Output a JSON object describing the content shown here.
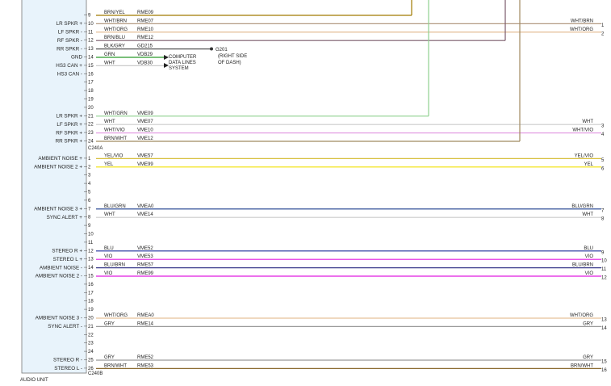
{
  "unit": {
    "name": "AUDIO UNIT",
    "fill": "#e8f3fb",
    "connectors": [
      {
        "name": "C240A",
        "after_pin": 24
      },
      {
        "name": "C240B",
        "after_pin": 48
      }
    ]
  },
  "ground": {
    "id": "G201",
    "note_lines": [
      "(RIGHT SIDE",
      "OF DASH)"
    ],
    "row": 13
  },
  "data_system": {
    "lines": [
      "COMPUTER",
      "DATA LINES",
      "SYSTEM"
    ],
    "rows": [
      14,
      15
    ]
  },
  "rows": [
    {
      "pin": "9",
      "signal": "",
      "color_text": "BRN/YEL",
      "circuit": "RME09",
      "wire": "#a07a00",
      "end": 510,
      "right_color": "",
      "right_num": ""
    },
    {
      "pin": "10",
      "signal": "LR SPKR +",
      "color_text": "WHT/BRN",
      "circuit": "RME07",
      "wire": "#b39a82",
      "end": 745,
      "right_color": "WHT/BRN",
      "right_num": "1"
    },
    {
      "pin": "11",
      "signal": "LF SPKR -",
      "color_text": "WHT/ORG",
      "circuit": "RME10",
      "wire": "#e0b68a",
      "end": 745,
      "right_color": "WHT/ORG",
      "right_num": "2"
    },
    {
      "pin": "12",
      "signal": "RF SPKR -",
      "color_text": "BRN/BLU",
      "circuit": "RME12",
      "wire": "#7a5a6a",
      "end": 626,
      "right_color": "",
      "right_num": ""
    },
    {
      "pin": "13",
      "signal": "RR SPKR -",
      "color_text": "BLK/GRY",
      "circuit": "GD215",
      "wire": "#555555",
      "end": 262,
      "right_color": "",
      "right_num": ""
    },
    {
      "pin": "14",
      "signal": "GND",
      "color_text": "GRN",
      "circuit": "VDB29",
      "wire": "#2a9a2a",
      "end": 203,
      "right_color": "",
      "right_num": ""
    },
    {
      "pin": "15",
      "signal": "HS3 CAN +",
      "color_text": "WHT",
      "circuit": "VDB30",
      "wire": "#cccccc",
      "end": 203,
      "right_color": "",
      "right_num": ""
    },
    {
      "pin": "16",
      "signal": "HS3 CAN -",
      "color_text": "",
      "circuit": "",
      "wire": "",
      "end": 0,
      "right_color": "",
      "right_num": ""
    },
    {
      "pin": "17",
      "signal": "",
      "color_text": "",
      "circuit": "",
      "wire": "",
      "end": 0,
      "right_color": "",
      "right_num": ""
    },
    {
      "pin": "18",
      "signal": "",
      "color_text": "",
      "circuit": "",
      "wire": "",
      "end": 0,
      "right_color": "",
      "right_num": ""
    },
    {
      "pin": "19",
      "signal": "",
      "color_text": "",
      "circuit": "",
      "wire": "",
      "end": 0,
      "right_color": "",
      "right_num": ""
    },
    {
      "pin": "20",
      "signal": "",
      "color_text": "",
      "circuit": "",
      "wire": "",
      "end": 0,
      "right_color": "",
      "right_num": ""
    },
    {
      "pin": "21",
      "signal": "LR SPKR +",
      "color_text": "WHT/GRN",
      "circuit": "VME09",
      "wire": "#8fd08f",
      "end": 531,
      "right_color": "",
      "right_num": ""
    },
    {
      "pin": "22",
      "signal": "LF SPKR +",
      "color_text": "WHT",
      "circuit": "VME07",
      "wire": "#cccccc",
      "end": 745,
      "right_color": "WHT",
      "right_num": "3"
    },
    {
      "pin": "23",
      "signal": "RF SPKR +",
      "color_text": "WHT/VIO",
      "circuit": "VME10",
      "wire": "#e4a0e4",
      "end": 745,
      "right_color": "WHT/VIO",
      "right_num": "4"
    },
    {
      "pin": "24",
      "signal": "RR SPKR +",
      "color_text": "BRN/WHT",
      "circuit": "VME12",
      "wire": "#a08a60",
      "end": 644,
      "right_color": "",
      "right_num": ""
    },
    {
      "pin": "1",
      "signal": "AMBIENT NOISE +",
      "color_text": "YEL/VIO",
      "circuit": "VME57",
      "wire": "#d8c040",
      "end": 745,
      "right_color": "YEL/VIO",
      "right_num": "5"
    },
    {
      "pin": "2",
      "signal": "AMBIENT NOISE 2 +",
      "color_text": "YEL",
      "circuit": "VME99",
      "wire": "#f0e000",
      "end": 745,
      "right_color": "YEL",
      "right_num": "6"
    },
    {
      "pin": "3",
      "signal": "",
      "color_text": "",
      "circuit": "",
      "wire": "",
      "end": 0,
      "right_color": "",
      "right_num": ""
    },
    {
      "pin": "4",
      "signal": "",
      "color_text": "",
      "circuit": "",
      "wire": "",
      "end": 0,
      "right_color": "",
      "right_num": ""
    },
    {
      "pin": "5",
      "signal": "",
      "color_text": "",
      "circuit": "",
      "wire": "",
      "end": 0,
      "right_color": "",
      "right_num": ""
    },
    {
      "pin": "6",
      "signal": "",
      "color_text": "",
      "circuit": "",
      "wire": "",
      "end": 0,
      "right_color": "",
      "right_num": ""
    },
    {
      "pin": "7",
      "signal": "AMBIENT NOISE 3 +",
      "color_text": "BLU/GRN",
      "circuit": "VMEA0",
      "wire": "#1a3c8c",
      "end": 745,
      "right_color": "BLU/GRN",
      "right_num": "7"
    },
    {
      "pin": "8",
      "signal": "SYNC ALERT +",
      "color_text": "WHT",
      "circuit": "VME14",
      "wire": "#cccccc",
      "end": 745,
      "right_color": "WHT",
      "right_num": "8"
    },
    {
      "pin": "9",
      "signal": "",
      "color_text": "",
      "circuit": "",
      "wire": "",
      "end": 0,
      "right_color": "",
      "right_num": ""
    },
    {
      "pin": "10",
      "signal": "",
      "color_text": "",
      "circuit": "",
      "wire": "",
      "end": 0,
      "right_color": "",
      "right_num": ""
    },
    {
      "pin": "11",
      "signal": "",
      "color_text": "",
      "circuit": "",
      "wire": "",
      "end": 0,
      "right_color": "",
      "right_num": ""
    },
    {
      "pin": "12",
      "signal": "STEREO R +",
      "color_text": "BLU",
      "circuit": "VME52",
      "wire": "#1a2a9a",
      "end": 745,
      "right_color": "BLU",
      "right_num": "9"
    },
    {
      "pin": "13",
      "signal": "STEREO L +",
      "color_text": "VIO",
      "circuit": "VME53",
      "wire": "#e01ae0",
      "end": 745,
      "right_color": "VIO",
      "right_num": "10"
    },
    {
      "pin": "14",
      "signal": "AMBIENT NOISE -",
      "color_text": "BLU/BRN",
      "circuit": "RME57",
      "wire": "#3a3a8a",
      "end": 745,
      "right_color": "BLU/BRN",
      "right_num": "11"
    },
    {
      "pin": "15",
      "signal": "AMBIENT NOISE 2 -",
      "color_text": "VIO",
      "circuit": "RME99",
      "wire": "#e01ae0",
      "end": 745,
      "right_color": "VIO",
      "right_num": "12"
    },
    {
      "pin": "16",
      "signal": "",
      "color_text": "",
      "circuit": "",
      "wire": "",
      "end": 0,
      "right_color": "",
      "right_num": ""
    },
    {
      "pin": "17",
      "signal": "",
      "color_text": "",
      "circuit": "",
      "wire": "",
      "end": 0,
      "right_color": "",
      "right_num": ""
    },
    {
      "pin": "18",
      "signal": "",
      "color_text": "",
      "circuit": "",
      "wire": "",
      "end": 0,
      "right_color": "",
      "right_num": ""
    },
    {
      "pin": "19",
      "signal": "",
      "color_text": "",
      "circuit": "",
      "wire": "",
      "end": 0,
      "right_color": "",
      "right_num": ""
    },
    {
      "pin": "20",
      "signal": "AMBIENT NOISE 3 -",
      "color_text": "WHT/ORG",
      "circuit": "RMEA0",
      "wire": "#e8c29a",
      "end": 745,
      "right_color": "WHT/ORG",
      "right_num": "13"
    },
    {
      "pin": "21",
      "signal": "SYNC ALERT -",
      "color_text": "GRY",
      "circuit": "RME14",
      "wire": "#999999",
      "end": 745,
      "right_color": "GRY",
      "right_num": "14"
    },
    {
      "pin": "22",
      "signal": "",
      "color_text": "",
      "circuit": "",
      "wire": "",
      "end": 0,
      "right_color": "",
      "right_num": ""
    },
    {
      "pin": "23",
      "signal": "",
      "color_text": "",
      "circuit": "",
      "wire": "",
      "end": 0,
      "right_color": "",
      "right_num": ""
    },
    {
      "pin": "24",
      "signal": "",
      "color_text": "",
      "circuit": "",
      "wire": "",
      "end": 0,
      "right_color": "",
      "right_num": ""
    },
    {
      "pin": "25",
      "signal": "STEREO R -",
      "color_text": "GRY",
      "circuit": "RME52",
      "wire": "#999999",
      "end": 745,
      "right_color": "GRY",
      "right_num": "15"
    },
    {
      "pin": "26",
      "signal": "STEREO L -",
      "color_text": "BRN/WHT",
      "circuit": "RME53",
      "wire": "#8a6a30",
      "end": 745,
      "right_color": "BRN/WHT",
      "right_num": "16"
    }
  ]
}
